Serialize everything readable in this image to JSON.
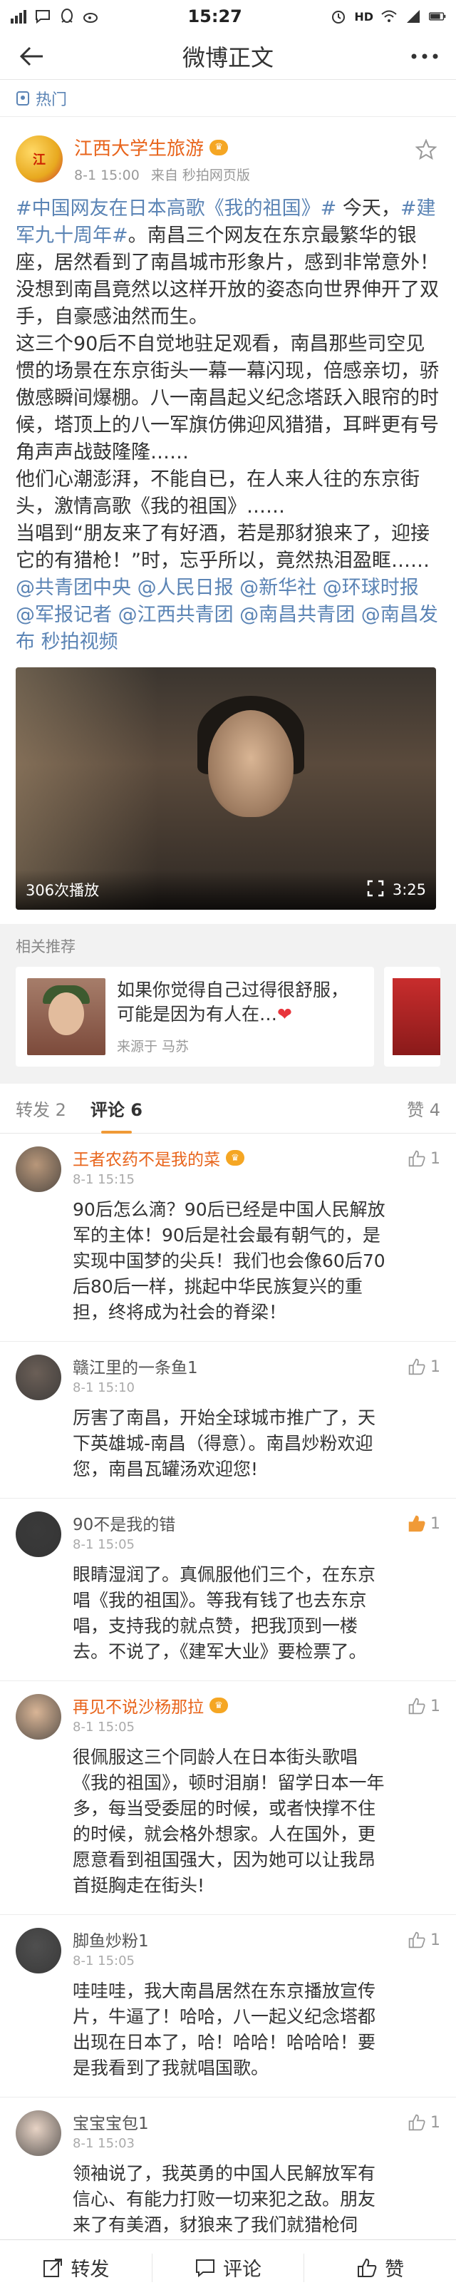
{
  "status_bar": {
    "time": "15:27",
    "network": "HD",
    "battery_level": 0.8,
    "left_icons": [
      "signal-4g-icon",
      "chat-bubble-icon",
      "qq-icon",
      "weibo-icon"
    ],
    "right_icons": [
      "alarm-icon",
      "wifi-icon",
      "signal-icon",
      "battery-icon"
    ]
  },
  "nav": {
    "title": "微博正文",
    "back_icon": "arrow-left-icon",
    "more_icon": "more-dots-icon"
  },
  "hot_label": "热门",
  "post": {
    "author": "江西大学生旅游",
    "avatar_text": "江",
    "time": "8-1 15:00",
    "source": "来自 秒拍网页版",
    "paragraphs": [
      [
        {
          "t": "#中国网友在日本高歌《我的祖国》#",
          "link": true
        },
        {
          "t": " 今天，",
          "link": false
        },
        {
          "t": "#建军九十周年#",
          "link": true
        },
        {
          "t": "。南昌三个网友在东京最繁华的银座，居然看到了南昌城市形象片，感到非常意外！没想到南昌竟然以这样开放的姿态向世界伸开了双手，自豪感油然而生。",
          "link": false
        }
      ],
      [
        {
          "t": "这三个90后不自觉地驻足观看，南昌那些司空见惯的场景在东京街头一幕一幕闪现，倍感亲切，骄傲感瞬间爆棚。八一南昌起义纪念塔跃入眼帘的时候，塔顶上的八一军旗仿佛迎风猎猎，耳畔更有号角声声战鼓隆隆……",
          "link": false
        }
      ],
      [
        {
          "t": "他们心潮澎湃，不能自已，在人来人往的东京街头，激情高歌《我的祖国》……",
          "link": false
        }
      ],
      [
        {
          "t": "当唱到“朋友来了有好酒，若是那豺狼来了，迎接它的有猎枪！”时，忘乎所以，竟然热泪盈眶……",
          "link": false
        },
        {
          "t": "@共青团中央 @人民日报 @新华社 @环球时报 @军报记者 @江西共青团 @南昌共青团 @南昌发布",
          "link": true
        },
        {
          "t": " ",
          "link": false
        },
        {
          "t": "秒拍视频",
          "link": true
        }
      ]
    ],
    "video": {
      "play_count": "306次播放",
      "duration": "3:25"
    }
  },
  "recommend": {
    "label": "相关推荐",
    "cards": [
      {
        "title": "如果你觉得自己过得很舒服，可能是因为有人在…",
        "source": "来源于 马苏"
      }
    ]
  },
  "tabs": [
    {
      "label": "转发 2",
      "active": false
    },
    {
      "label": "评论 6",
      "active": true
    },
    {
      "label": "赞 4",
      "active": false
    }
  ],
  "comments": [
    {
      "name": "王者农药不是我的菜",
      "vip": true,
      "time": "8-1 15:15",
      "likes": "1",
      "liked": false,
      "avatar_color": "#b8977a",
      "text": "90后怎么滴？90后已经是中国人民解放军的主体！90后是社会最有朝气的，是实现中国梦的尖兵！我们也会像60后70后80后一样，挑起中华民族复兴的重担，终将成为社会的脊梁！"
    },
    {
      "name": "赣江里的一条鱼1",
      "vip": false,
      "time": "8-1 15:10",
      "likes": "1",
      "liked": false,
      "avatar_color": "#6b5f57",
      "text": "厉害了南昌，开始全球城市推广了，天下英雄城-南昌（得意）。南昌炒粉欢迎您，南昌瓦罐汤欢迎您!"
    },
    {
      "name": "90不是我的错",
      "vip": false,
      "time": "8-1 15:05",
      "likes": "1",
      "liked": true,
      "avatar_color": "#3a3a3a",
      "text": "眼睛湿润了。真佩服他们三个，在东京唱《我的祖国》。等我有钱了也去东京唱，支持我的就点赞，把我顶到一楼去。不说了，《建军大业》要检票了。"
    },
    {
      "name": "再见不说沙杨那拉",
      "vip": true,
      "time": "8-1 15:05",
      "likes": "1",
      "liked": false,
      "avatar_color": "#d9b596",
      "text": "很佩服这三个同龄人在日本街头歌唱《我的祖国》，顿时泪崩！留学日本一年多，每当受委屈的时候，或者快撑不住的时候，就会格外想家。人在国外，更愿意看到祖国强大，因为她可以让我昂首挺胸走在街头!"
    },
    {
      "name": "脚鱼炒粉1",
      "vip": false,
      "time": "8-1 15:05",
      "likes": "1",
      "liked": false,
      "avatar_color": "#4f4f4f",
      "text": "哇哇哇，我大南昌居然在东京播放宣传片，牛逼了！哈哈，八一起义纪念塔都出现在日本了，哈！哈哈！哈哈哈！要是我看到了我就唱国歌。"
    },
    {
      "name": "宝宝宝包1",
      "vip": false,
      "time": "8-1 15:03",
      "likes": "1",
      "liked": false,
      "avatar_color": "#e7d3c5",
      "text": "领袖说了，我英勇的中国人民解放军有信心、有能力打败一切来犯之敌。朋友来了有美酒，豺狼来了我们就猎枪伺候。中国任人宰割的时代已经一去不复返了。"
    }
  ],
  "bottom_bar": {
    "repost": "转发",
    "comment": "评论",
    "like": "赞"
  },
  "colors": {
    "accent_link": "#5b84b5",
    "author_orange": "#e8641b",
    "tab_underline": "#f09a37",
    "like_active": "#f09a37"
  }
}
